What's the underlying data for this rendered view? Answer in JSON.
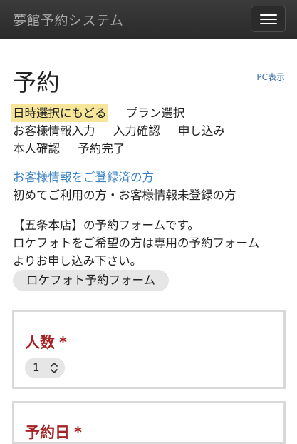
{
  "nav": {
    "brand": "夢館予約システム",
    "toggle_icon": "hamburger-menu-icon"
  },
  "page": {
    "title": "予約",
    "pc_link": "PC表示"
  },
  "steps": [
    [
      "日時選択にもどる",
      "プラン選択"
    ],
    [
      "お客様情報入力",
      "入力確認",
      "申し込み"
    ],
    [
      "本人確認",
      "予約完了"
    ]
  ],
  "steps_flat": {
    "s0": "日時選択にもどる",
    "s1": "プラン選択",
    "s2": "お客様情報入力",
    "s3": "入力確認",
    "s4": "申し込み",
    "s5": "本人確認",
    "s6": "予約完了"
  },
  "customer": {
    "registered_link": "お客様情報をご登録済の方",
    "new_user_text": "初めてご利用の方・お客様情報未登録の方"
  },
  "notice": {
    "line1": "【五条本店】の予約フォームです。",
    "line2": "ロケフォトをご希望の方は専用の予約フォーム",
    "line3": "よりお申し込み下さい。",
    "button": "ロケフォト予約フォーム"
  },
  "form": {
    "people_label": "人数",
    "people_value": "1",
    "required_mark": "*",
    "date_label": "予約日"
  },
  "colors": {
    "navbar": "#343434",
    "highlight": "#f7e69a",
    "link": "#3a82c4",
    "label_red": "#a32424"
  }
}
